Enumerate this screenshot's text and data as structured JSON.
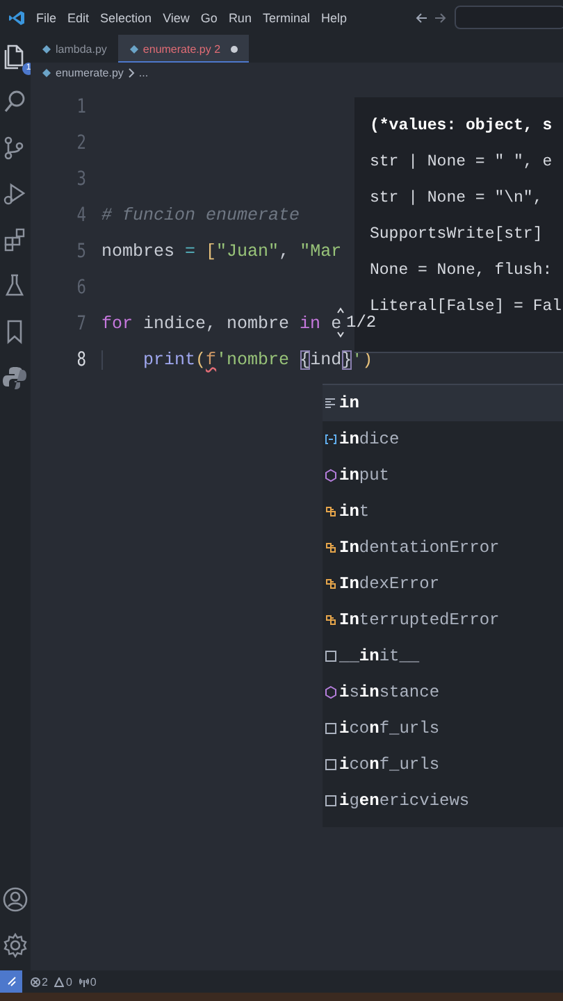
{
  "menu_bar": {
    "items": [
      "File",
      "Edit",
      "Selection",
      "View",
      "Go",
      "Run",
      "Terminal",
      "Help"
    ]
  },
  "activity_bar": {
    "top": [
      {
        "kind": "explorer",
        "badge": "1"
      },
      {
        "kind": "search"
      },
      {
        "kind": "source-control"
      },
      {
        "kind": "run"
      },
      {
        "kind": "extensions"
      },
      {
        "kind": "testing"
      },
      {
        "kind": "bookmark"
      },
      {
        "kind": "python"
      }
    ],
    "bottom": [
      {
        "kind": "account"
      },
      {
        "kind": "settings"
      }
    ]
  },
  "tabs": [
    {
      "label": "lambda.py",
      "selected": false,
      "has_errors": false,
      "modified": false
    },
    {
      "label": "enumerate.py",
      "problems": "2",
      "selected": true,
      "has_errors": true,
      "modified": true
    }
  ],
  "breadcrumb": [
    "enumerate.py",
    "..."
  ],
  "editor": {
    "lines": [
      {
        "number": "1",
        "current": false
      },
      {
        "number": "2",
        "current": false
      },
      {
        "number": "3",
        "current": false
      },
      {
        "number": "4",
        "current": false,
        "tokens": [
          {
            "text": "# funcion enumerate",
            "kind": "comment"
          }
        ]
      },
      {
        "number": "5",
        "current": false,
        "tokens": [
          {
            "text": "nombres ",
            "kind": "plain"
          },
          {
            "text": "= ",
            "kind": "operator"
          },
          {
            "text": "[",
            "kind": "bracket"
          },
          {
            "text": "\"Juan\"",
            "kind": "string"
          },
          {
            "text": ", ",
            "kind": "plain"
          },
          {
            "text": "\"Mar",
            "kind": "string"
          }
        ]
      },
      {
        "number": "6",
        "current": false
      },
      {
        "number": "7",
        "current": false,
        "tokens": [
          {
            "text": "for",
            "kind": "keyword"
          },
          {
            "text": " indice, nombre ",
            "kind": "plain"
          },
          {
            "text": "in",
            "kind": "keyword"
          },
          {
            "text": " e",
            "kind": "plain"
          }
        ]
      },
      {
        "number": "8",
        "current": true,
        "indent": true,
        "tokens": [
          {
            "text": "print",
            "kind": "function"
          },
          {
            "text": "(",
            "kind": "bracket"
          },
          {
            "text": "f",
            "kind": "fprefix"
          },
          {
            "text": "'nombre ",
            "kind": "string"
          },
          {
            "text": "{",
            "kind": "brace-match"
          },
          {
            "text": "ind",
            "kind": "plain"
          },
          {
            "text": "}",
            "kind": "brace-match"
          },
          {
            "text": "'",
            "kind": "string"
          },
          {
            "text": ")",
            "kind": "bracket"
          }
        ]
      }
    ]
  },
  "signature_help": {
    "counter": "1/2",
    "lines": [
      "(*values: object, s",
      "str | None = \" \", e",
      "str | None = \"\\n\", ",
      "SupportsWrite[str]",
      "None = None, flush:",
      "Literal[False] = Fal"
    ]
  },
  "suggestions": [
    {
      "label": "in",
      "full_match": true,
      "kind": "keyword",
      "selected": true
    },
    {
      "label": "**in**dice",
      "kind": "variable",
      "selected": false
    },
    {
      "label": "**in**put",
      "kind": "function",
      "selected": false
    },
    {
      "label": "**in**t",
      "kind": "class",
      "selected": false
    },
    {
      "label": "**In**dentationError",
      "kind": "class",
      "selected": false
    },
    {
      "label": "**In**dexError",
      "kind": "class",
      "selected": false
    },
    {
      "label": "**In**terruptedError",
      "kind": "class",
      "selected": false
    },
    {
      "label": "__**in**it__",
      "kind": "text",
      "selected": false
    },
    {
      "label": "**i**s**in**stance",
      "kind": "function",
      "selected": false
    },
    {
      "label": "**i**co**n**f_urls",
      "kind": "text",
      "selected": false
    },
    {
      "label": "**i**co**n**f_urls",
      "kind": "text",
      "selected": false
    },
    {
      "label": "**i**g**en**ericviews",
      "kind": "text",
      "selected": false
    }
  ],
  "status_bar": {
    "errors": "2",
    "warnings": "0",
    "ports": "0"
  }
}
